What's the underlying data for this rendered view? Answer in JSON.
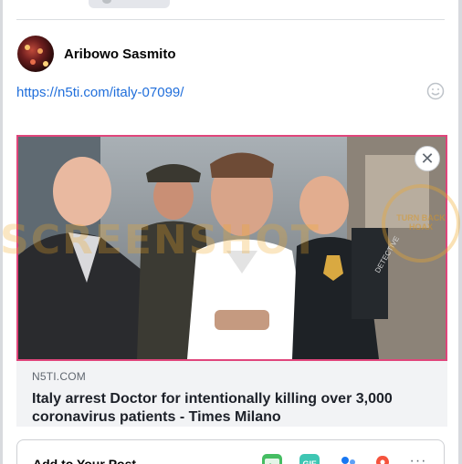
{
  "composer": {
    "author_name": "Aribowo Sasmito",
    "link_url": "https://n5ti.com/italy-07099/",
    "link_preview": {
      "domain": "N5TI.COM",
      "title": "Italy arrest Doctor for intentionally killing over 3,000 coronavirus patients - Times Milano",
      "close_symbol": "✕"
    },
    "add_to_post": {
      "label": "Add to Your Post",
      "gif_label": "GIF",
      "more_label": "···"
    }
  },
  "watermark": {
    "text": "SCREENSHOT",
    "badge_text": "TURN BACK HOAX"
  },
  "colors": {
    "link": "#216fdb",
    "highlight_border": "#e0457b",
    "photo_icon": "#45bd62",
    "gif_icon": "#3ec6b3",
    "tag_icon": "#1877f2",
    "pin_icon": "#f5533d"
  },
  "icons": [
    "emoji-icon",
    "close-icon",
    "photo-icon",
    "gif-icon",
    "tag-people-icon",
    "location-pin-icon",
    "more-icon"
  ]
}
